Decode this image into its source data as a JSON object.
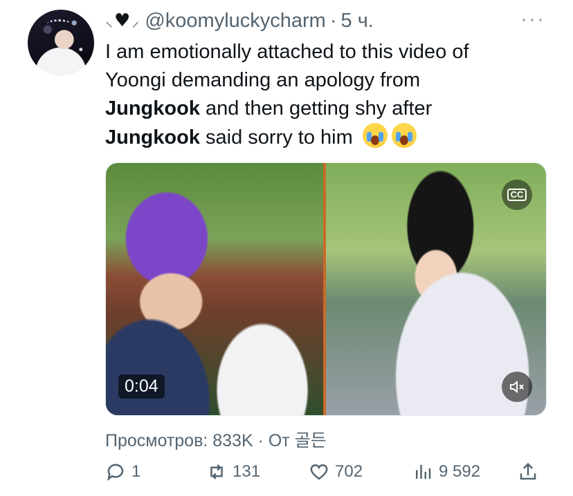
{
  "author": {
    "handle": "@koomyluckycharm",
    "time": "5 ч."
  },
  "tweet": {
    "line1": "I am emotionally attached to this video of",
    "line2": "Yoongi demanding an apology from",
    "bold1": "Jungkook",
    "line3_rest": " and then getting shy after",
    "bold2": "Jungkook",
    "line4_rest": " said sorry to him"
  },
  "media": {
    "timestamp": "0:04",
    "cc_label": "CC"
  },
  "stats": {
    "views": "Просмотров: 833K · От 골든"
  },
  "actions": {
    "replies": "1",
    "retweets": "131",
    "likes": "702",
    "views": "9 592"
  },
  "icons": [
    "more-icon",
    "cc-icon",
    "mute-icon",
    "reply-icon",
    "retweet-icon",
    "like-icon",
    "views-icon",
    "share-icon"
  ]
}
